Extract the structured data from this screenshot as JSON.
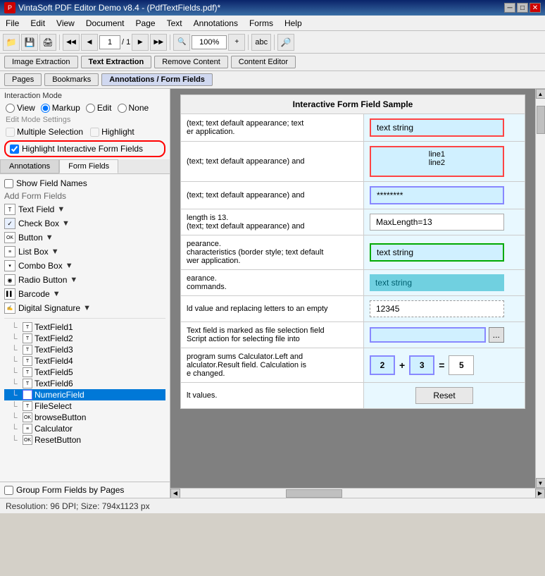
{
  "titlebar": {
    "title": "VintaSoft PDF Editor Demo v8.4 - (PdfTextFields.pdf)*",
    "icon": "pdf"
  },
  "menubar": {
    "items": [
      "File",
      "Edit",
      "View",
      "Document",
      "Page",
      "Text",
      "Annotations",
      "Forms",
      "Help"
    ]
  },
  "toolbar": {
    "page_input": "1",
    "page_total": "/ 1",
    "zoom_input": "100%",
    "nav_first": "◀◀",
    "nav_prev": "◀",
    "nav_next": "▶",
    "nav_last": "▶▶",
    "zoom_out": "🔍-",
    "zoom_in": "🔍+"
  },
  "tab_row1": {
    "image_extraction": "Image Extraction",
    "text_extraction": "Text Extraction",
    "remove_content": "Remove Content",
    "content_editor": "Content Editor"
  },
  "tab_row2": {
    "pages": "Pages",
    "bookmarks": "Bookmarks",
    "annotations": "Annotations / Form Fields"
  },
  "left_panel": {
    "interaction_mode_label": "Interaction Mode",
    "view_label": "View",
    "markup_label": "Markup",
    "edit_label": "Edit",
    "none_label": "None",
    "edit_mode_label": "Edit Mode Settings",
    "multiple_selection_label": "Multiple Selection",
    "highlight_label": "Highlight",
    "highlight_form_fields_label": "Highlight Interactive Form Fields",
    "annotations_tab": "Annotations",
    "form_fields_tab": "Form Fields",
    "show_field_names": "Show Field Names",
    "add_form_fields": "Add Form Fields",
    "text_field": "Text Field",
    "check_box": "Check Box",
    "button": "Button",
    "list_box": "List Box",
    "combo_box": "Combo Box",
    "radio_button": "Radio Button",
    "barcode": "Barcode",
    "digital_signature": "Digital Signature",
    "tree_items": [
      "TextField1",
      "TextField2",
      "TextField3",
      "TextField4",
      "TextField5",
      "TextField6",
      "NumericField",
      "FileSelect",
      "browseButton",
      "Calculator",
      "ResetButton"
    ],
    "group_by_pages": "Group Form Fields by Pages"
  },
  "pdf_area": {
    "header": "Interactive Form Field Sample",
    "rows": [
      {
        "desc": "(text; text default appearance; text\ner application.",
        "sample_type": "text_field",
        "sample_value": "text string"
      },
      {
        "desc": "(text; text default appearance) and",
        "sample_type": "multiline",
        "sample_value": "line1\nline2"
      },
      {
        "desc": "(text; text default appearance) and",
        "sample_type": "password",
        "sample_value": "********"
      },
      {
        "desc": "length is 13.\n(text; text default appearance) and",
        "sample_type": "maxlen",
        "sample_value": "MaxLength=13"
      },
      {
        "desc": "pearance.\ncharacteristics (border style; text default\nwer application.",
        "sample_type": "green",
        "sample_value": "text string"
      },
      {
        "desc": "earance.\ncommands.",
        "sample_type": "teal",
        "sample_value": "text string"
      },
      {
        "desc": "ld value and replacing letters to an empty",
        "sample_type": "numeric",
        "sample_value": "12345"
      },
      {
        "desc": "Text field is marked as file selection field\nScript action for selecting file into",
        "sample_type": "file",
        "sample_value": "",
        "btn_label": "..."
      },
      {
        "desc": "program sums Calculator.Left and\nalculator.Result field. Calculation is\ne changed.",
        "sample_type": "calc",
        "val1": "2",
        "op1": "+",
        "val2": "3",
        "eq": "=",
        "result": "5"
      },
      {
        "desc": "lt values.",
        "sample_type": "reset",
        "btn_label": "Reset"
      }
    ]
  },
  "statusbar": {
    "text": "Resolution: 96 DPI; Size: 794x1123 px"
  },
  "titlebar_btns": {
    "minimize": "─",
    "restore": "□",
    "close": "✕"
  }
}
